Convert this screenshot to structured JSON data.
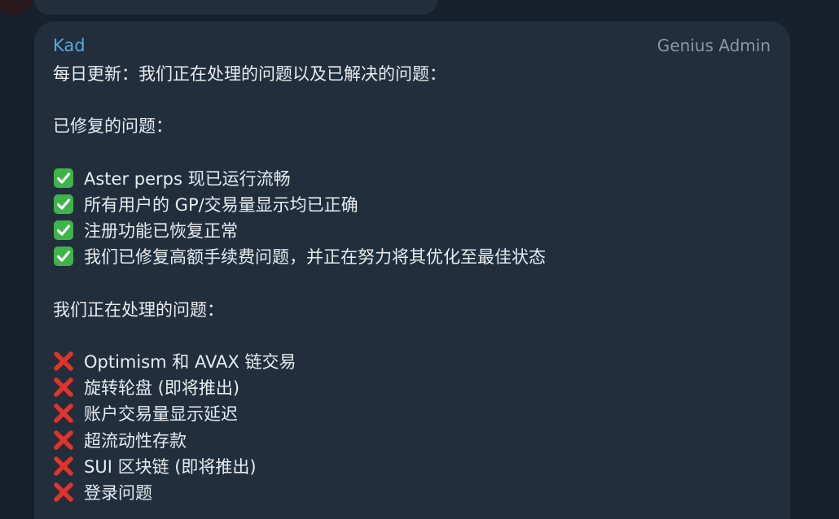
{
  "message": {
    "sender": "Kad",
    "badge": "Genius Admin",
    "header": "每日更新：我们正在处理的问题以及已解决的问题：",
    "fixed_title": "已修复的问题：",
    "fixed_items": [
      "Aster perps 现已运行流畅",
      "所有用户的 GP/交易量显示均已正确",
      "注册功能已恢复正常",
      "我们已修复高额手续费问题，并正在努力将其优化至最佳状态"
    ],
    "working_title": "我们正在处理的问题：",
    "working_items": [
      "Optimism 和 AVAX 链交易",
      "旋转轮盘 (即将推出)",
      "账户交易量显示延迟",
      "超流动性存款",
      "SUI 区块链 (即将推出)",
      "登录问题"
    ],
    "fixed_icon": "check-mark-emoji-icon",
    "pending_icon": "cross-mark-emoji-icon"
  },
  "colors": {
    "background": "#17212b",
    "bubble": "#222e3c",
    "sender": "#5ea7d8",
    "badge": "#8a97a6",
    "text": "#e8ecf0",
    "check_green": "#3fb44a",
    "cross_red": "#e0342a"
  }
}
